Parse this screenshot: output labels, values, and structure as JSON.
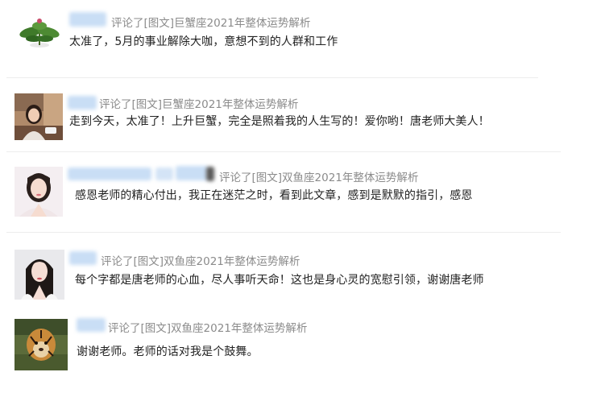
{
  "comments": [
    {
      "avatar": "plant-avatar",
      "action": "评论了[图文]巨蟹座2021年整体运势解析",
      "text": "太准了，5月的事业解除大咖，意想不到的人群和工作"
    },
    {
      "avatar": "woman-cafe-avatar",
      "action": "评论了[图文]巨蟹座2021年整体运势解析",
      "text": "走到今天，太准了！上升巨蟹，完全是照着我的人生写的！爱你哟！唐老师大美人！"
    },
    {
      "avatar": "woman-portrait-avatar",
      "action": "评论了[图文]双鱼座2021年整体运势解析",
      "text": "感恩老师的精心付出，我正在迷茫之时，看到此文章，感到是默默的指引，感恩"
    },
    {
      "avatar": "woman-longhair-avatar",
      "action": "评论了[图文]双鱼座2021年整体运势解析",
      "text": "每个字都是唐老师的心血，尽人事听天命！这也是身心灵的宽慰引领，谢谢唐老师"
    },
    {
      "avatar": "tiger-avatar",
      "action": "评论了[图文]双鱼座2021年整体运势解析",
      "text": "谢谢老师。老师的话对我是个鼓舞。"
    }
  ]
}
